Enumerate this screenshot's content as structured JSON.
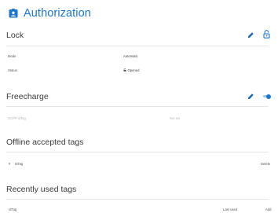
{
  "header": {
    "title": "Authorization",
    "icon": "badge-icon",
    "accent": "#1976d2"
  },
  "lock": {
    "title": "Lock",
    "mode_label": "Mode",
    "mode_value": "Automatic",
    "status_label": "Status",
    "status_value": "Opened",
    "edit_icon": "pencil-icon",
    "status_icon": "lock-open-icon"
  },
  "freecharge": {
    "title": "Freecharge",
    "idtag_label": "OCPP idTag",
    "idtag_value": "Not set",
    "edit_icon": "pencil-icon",
    "toggle_on": true
  },
  "offline_tags": {
    "title": "Offline accepted tags",
    "columns": [
      "#",
      "IdTag",
      "Delete"
    ]
  },
  "recent_tags": {
    "title": "Recently used tags",
    "columns": [
      "IdTag",
      "Last used",
      "Add"
    ]
  }
}
